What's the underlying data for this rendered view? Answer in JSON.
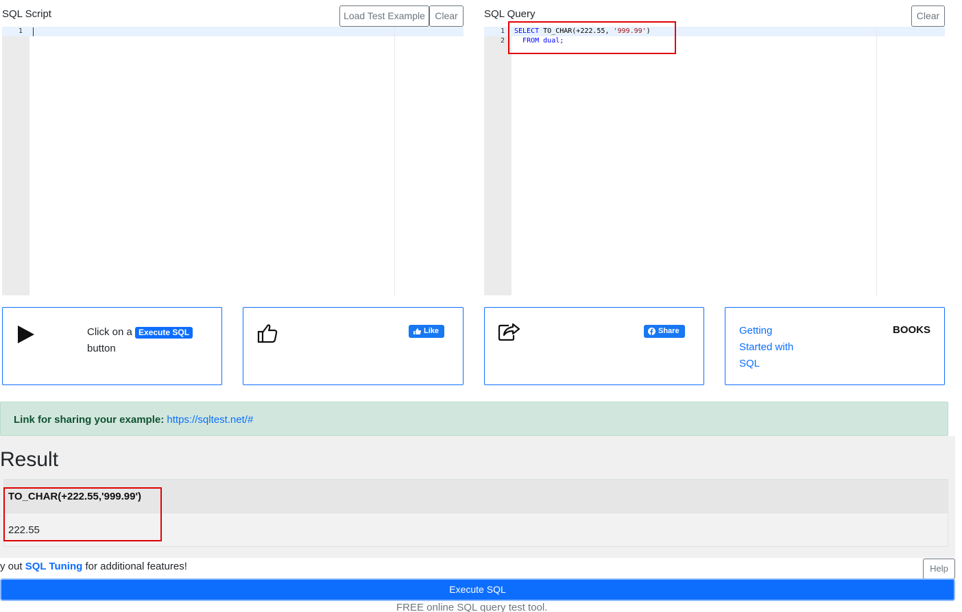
{
  "script_panel": {
    "title": "SQL Script",
    "load_example_label": "Load Test Example",
    "clear_label": "Clear",
    "line_numbers": [
      "1"
    ]
  },
  "query_panel": {
    "title": "SQL Query",
    "clear_label": "Clear",
    "line_numbers": [
      "1",
      "2"
    ],
    "code": {
      "line1_kw": "SELECT",
      "line1_rest": " TO_CHAR(+222.55, ",
      "line1_str": "'999.99'",
      "line1_end": ")",
      "line2_indent": "  ",
      "line2_kw": "FROM",
      "line2_rest": " dual;"
    }
  },
  "cards": {
    "execute": {
      "text_before": "Click on a",
      "badge": "Execute SQL",
      "text_after": "button",
      "icon": "play-icon"
    },
    "like": {
      "button": "Like",
      "icon": "thumbs-up-icon"
    },
    "share": {
      "button": "Share",
      "icon": "share-arrow-icon"
    },
    "books": {
      "link": "Getting Started with SQL",
      "label": "BOOKS"
    }
  },
  "share_link": {
    "label": "Link for sharing your example:",
    "url": "https://sqltest.net/#"
  },
  "result": {
    "heading": "Result",
    "column": "TO_CHAR(+222.55,'999.99')",
    "value": "222.55"
  },
  "promo": {
    "text_before": "y out ",
    "link": "SQL Tuning",
    "text_after": " for additional features!",
    "help_label": "Help"
  },
  "execute_bar": {
    "label": "Execute SQL"
  },
  "footer": {
    "text": "FREE online SQL query test tool."
  },
  "colors": {
    "primary": "#0d6efd",
    "facebook": "#1877f2",
    "success_bg": "#d1e7dd",
    "highlight": "#e00000"
  }
}
